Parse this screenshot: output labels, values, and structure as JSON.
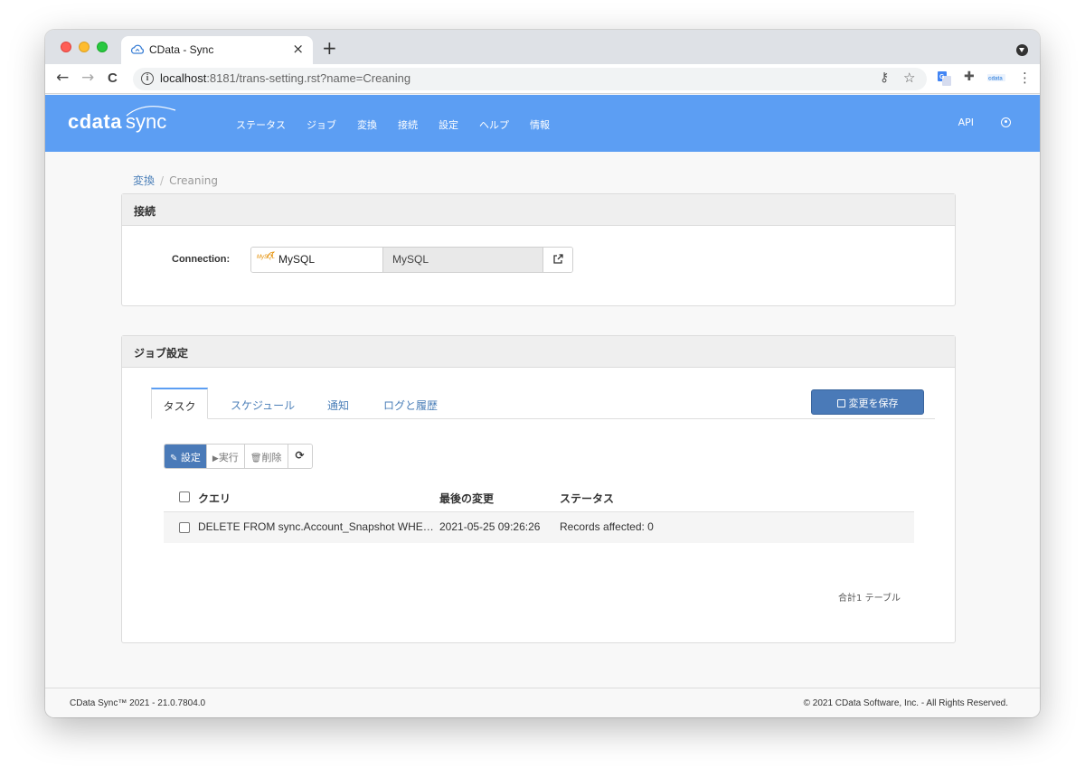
{
  "browser": {
    "tab_title": "CData - Sync",
    "close_glyph": "×",
    "new_tab_glyph": "+",
    "url_host": "localhost",
    "url_rest": ":8181/trans-setting.rst?name=Creaning",
    "back_glyph": "←",
    "forward_glyph": "→",
    "reload_glyph": "C",
    "info_glyph": "i",
    "key_glyph": "⚷",
    "star_glyph": "☆",
    "extensions_glyph": "✚",
    "menu_glyph": "⋮"
  },
  "header": {
    "logo_cdata": "cdata",
    "logo_sync": "sync",
    "nav": [
      "ステータス",
      "ジョブ",
      "変換",
      "接続",
      "設定",
      "ヘルプ",
      "情報"
    ],
    "api_label": "API",
    "accent_color": "#5c9ef3"
  },
  "breadcrumb": {
    "parent": "変換",
    "separator": "/",
    "current": "Creaning"
  },
  "connection_panel": {
    "title": "接続",
    "label": "Connection:",
    "mysql_logo_text": "MySQL",
    "selected": "MySQL",
    "readonly_value": "MySQL"
  },
  "job_panel": {
    "title": "ジョブ設定",
    "tabs": [
      "タスク",
      "スケジュール",
      "通知",
      "ログと履歴"
    ],
    "save_label": "変更を保存",
    "toolbar": {
      "edit_label": "設定",
      "run_label": "実行",
      "delete_label": "削除",
      "refresh_glyph": "⟳"
    },
    "columns": {
      "query": "クエリ",
      "last_modified": "最後の変更",
      "status": "ステータス"
    },
    "rows": [
      {
        "query": "DELETE FROM sync.Account_Snapshot WHE…",
        "last_modified": "2021-05-25 09:26:26",
        "status": "Records affected: 0"
      }
    ],
    "total": "合計1 テーブル"
  },
  "footer": {
    "version": "CData Sync™ 2021 - 21.0.7804.0",
    "copyright": "© 2021 CData Software, Inc. - All Rights Reserved."
  }
}
